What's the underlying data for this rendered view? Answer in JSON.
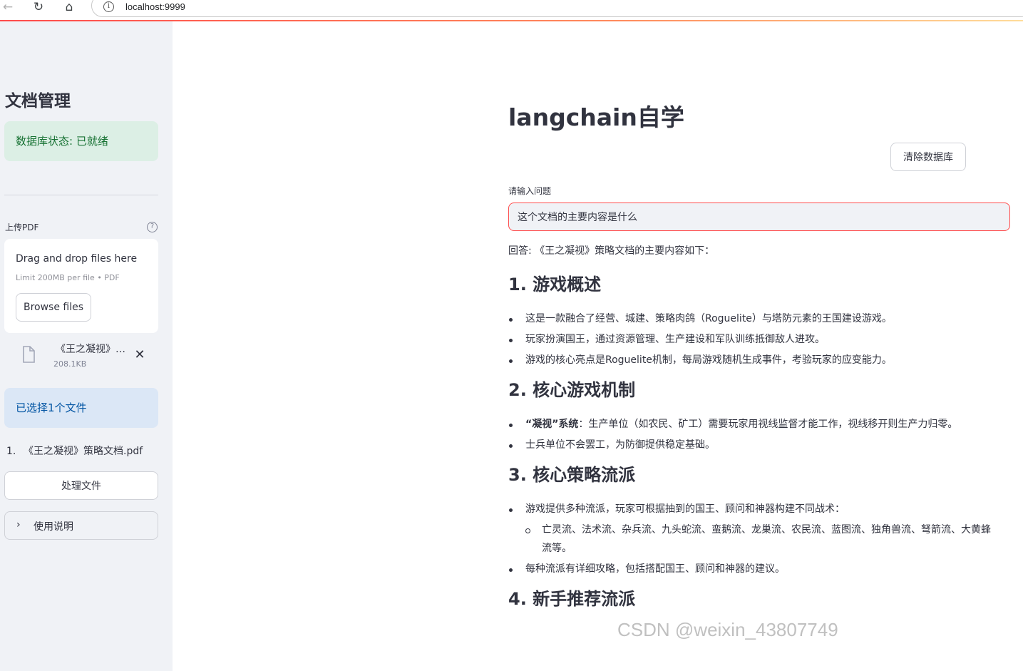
{
  "browser": {
    "url": "localhost:9999"
  },
  "sidebar": {
    "title": "文档管理",
    "db_status": "数据库状态: 已就绪",
    "upload_label": "上传PDF",
    "dropzone": {
      "title": "Drag and drop files here",
      "limit": "Limit 200MB per file • PDF",
      "browse_label": "Browse files"
    },
    "uploaded_file": {
      "name": "《王之凝视》…",
      "size": "208.1KB"
    },
    "selected_info": "已选择1个文件",
    "file_list": [
      {
        "num": "1.",
        "name": "《王之凝视》策略文档.pdf"
      }
    ],
    "process_label": "处理文件",
    "usage_label": "使用说明"
  },
  "main": {
    "title": "langchain自学",
    "clear_label": "清除数据库",
    "input_label": "请输入问题",
    "input_value": "这个文档的主要内容是什么",
    "answer_intro": "回答: 《王之凝视》策略文档的主要内容如下：",
    "sections": [
      {
        "heading": "1. 游戏概述",
        "items": [
          "这是一款融合了经营、城建、策略肉鸽（Roguelite）与塔防元素的王国建设游戏。",
          "玩家扮演国王，通过资源管理、生产建设和军队训练抵御敌人进攻。",
          "游戏的核心亮点是Roguelite机制，每局游戏随机生成事件，考验玩家的应变能力。"
        ]
      },
      {
        "heading": "2. 核心游戏机制",
        "items_bold_first": {
          "bold": "“凝视”系统",
          "rest": "：生产单位（如农民、矿工）需要玩家用视线监督才能工作，视线移开则生产力归零。"
        },
        "items": [
          "士兵单位不会罢工，为防御提供稳定基础。"
        ]
      },
      {
        "heading": "3. 核心策略流派",
        "item1": "游戏提供多种流派，玩家可根据抽到的国王、顾问和神器构建不同战术：",
        "sub": "亡灵流、法术流、杂兵流、九头蛇流、蛮鹅流、龙巢流、农民流、蓝图流、独角兽流、弩箭流、大黄蜂流等。",
        "item2": "每种流派有详细攻略，包括搭配国王、顾问和神器的建议。"
      },
      {
        "heading": "4. 新手推荐流派"
      }
    ]
  },
  "watermark": "CSDN @weixin_43807749",
  "colors": {
    "accent": "#ff4b4b",
    "success_bg": "#dcefe5",
    "info_bg": "#dbe7f6",
    "sidebar_bg": "#f0f2f6"
  }
}
